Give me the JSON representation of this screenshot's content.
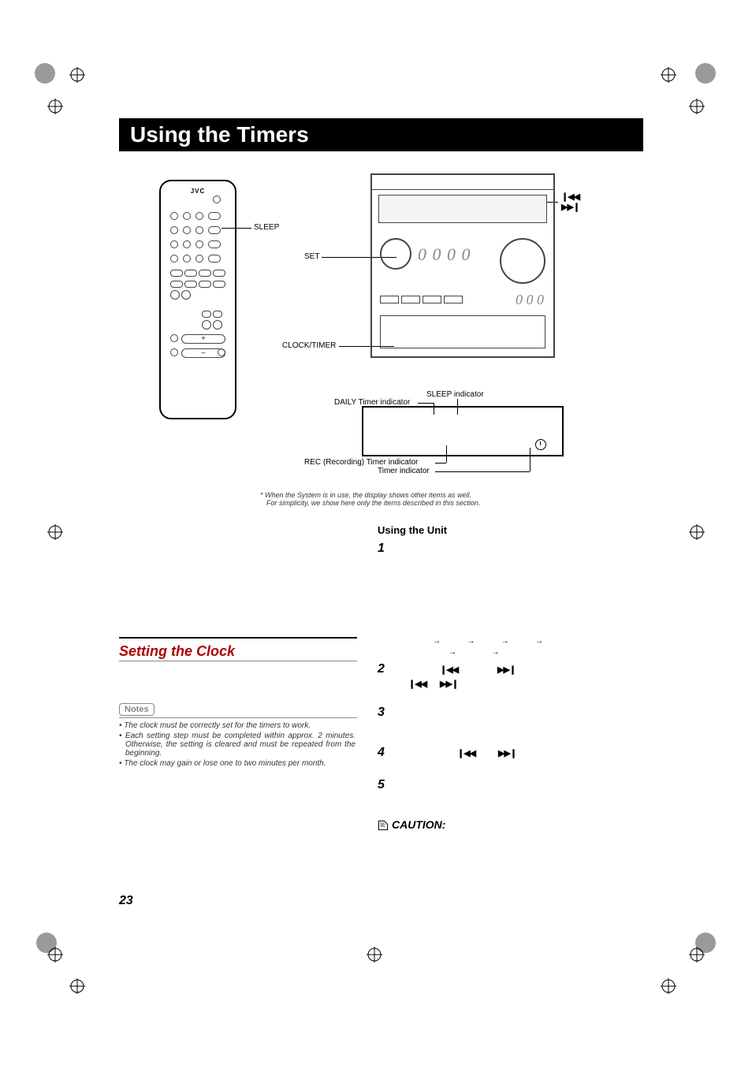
{
  "title": "Using the Timers",
  "labels": {
    "sleep": "SLEEP",
    "set": "SET",
    "clock_timer": "CLOCK/TIMER",
    "sleep_indicator": "SLEEP indicator",
    "daily_indicator": "DAILY Timer indicator",
    "rec_indicator": "REC (Recording) Timer indicator",
    "timer_indicator": "Timer indicator",
    "remote_brand": "JVC"
  },
  "footnote_1": "* When the System is in use, the display shows other items as well.",
  "footnote_2": "For simplicity, we show here only the items described in this section.",
  "using_unit": "Using the Unit",
  "setting_clock": "Setting the Clock",
  "notes_label": "Notes",
  "notes": [
    "• The clock must be correctly set for the timers to work.",
    "• Each setting step must be completed within approx. 2 minutes. Otherwise, the setting is cleared and must be repeated from the beginning.",
    "• The clock may gain or lose one to two minutes per month."
  ],
  "steps": [
    "1",
    "2",
    "3",
    "4",
    "5"
  ],
  "caution": "CAUTION:",
  "page": "23",
  "track_symbols": {
    "prev": "❙◀◀",
    "next": "▶▶❙",
    "right_arrow": "→"
  }
}
